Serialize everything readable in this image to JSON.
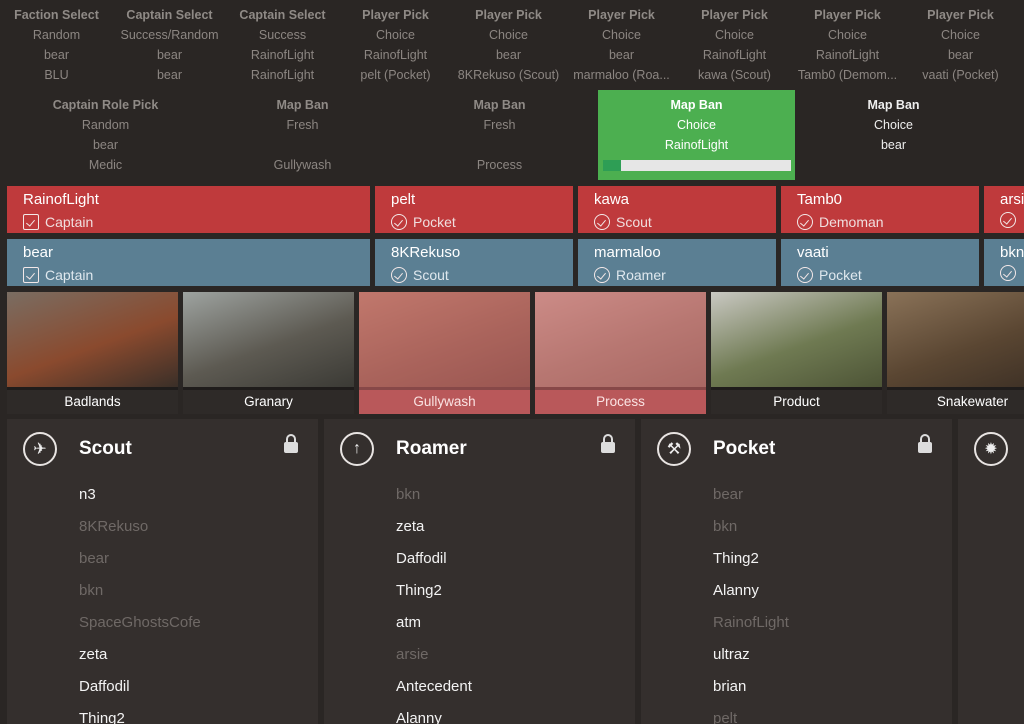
{
  "history_row1": [
    {
      "heading": "Faction Select",
      "lines": [
        "Random",
        "bear",
        "BLU"
      ]
    },
    {
      "heading": "Captain Select",
      "lines": [
        "Success/Random",
        "bear",
        "bear"
      ]
    },
    {
      "heading": "Captain Select",
      "lines": [
        "Success",
        "RainofLight",
        "RainofLight"
      ]
    },
    {
      "heading": "Player Pick",
      "lines": [
        "Choice",
        "RainofLight",
        "pelt (Pocket)"
      ]
    },
    {
      "heading": "Player Pick",
      "lines": [
        "Choice",
        "bear",
        "8KRekuso (Scout)"
      ]
    },
    {
      "heading": "Player Pick",
      "lines": [
        "Choice",
        "bear",
        "marmaloo (Roa..."
      ]
    },
    {
      "heading": "Player Pick",
      "lines": [
        "Choice",
        "RainofLight",
        "kawa (Scout)"
      ]
    },
    {
      "heading": "Player Pick",
      "lines": [
        "Choice",
        "RainofLight",
        "Tamb0 (Demom..."
      ]
    },
    {
      "heading": "Player Pick",
      "lines": [
        "Choice",
        "bear",
        "vaati (Pocket)"
      ]
    }
  ],
  "history_row2": [
    {
      "heading": "Captain Role Pick",
      "lines": [
        "Random",
        "bear",
        "Medic"
      ]
    },
    {
      "heading": "Map Ban",
      "lines": [
        "Fresh",
        "",
        "Gullywash"
      ]
    },
    {
      "heading": "Map Ban",
      "lines": [
        "Fresh",
        "",
        "Process"
      ]
    },
    {
      "heading": "Map Ban",
      "lines": [
        "Choice",
        "RainofLight"
      ],
      "active": true,
      "progress": 0.1
    },
    {
      "heading": "Map Ban",
      "lines": [
        "Choice",
        "bear"
      ],
      "white": true
    }
  ],
  "red_team": [
    {
      "name": "RainofLight",
      "role": "Captain",
      "icon": "clipboard-check-icon"
    },
    {
      "name": "pelt",
      "role": "Pocket",
      "icon": "pocket-icon"
    },
    {
      "name": "kawa",
      "role": "Scout",
      "icon": "scout-icon"
    },
    {
      "name": "Tamb0",
      "role": "Demoman",
      "icon": "demoman-icon"
    },
    {
      "name": "arsi",
      "role": "",
      "icon": "medic-icon"
    }
  ],
  "blu_team": [
    {
      "name": "bear",
      "role": "Captain",
      "icon": "clipboard-check-icon"
    },
    {
      "name": "8KRekuso",
      "role": "Scout",
      "icon": "scout-icon"
    },
    {
      "name": "marmaloo",
      "role": "Roamer",
      "icon": "roamer-icon"
    },
    {
      "name": "vaati",
      "role": "Pocket",
      "icon": "pocket-icon"
    },
    {
      "name": "bkn",
      "role": "",
      "icon": "medic-icon"
    }
  ],
  "maps": [
    {
      "name": "Badlands",
      "banned": false,
      "colors": [
        "#7a6d62",
        "#8a4a2e",
        "#3a2f28"
      ]
    },
    {
      "name": "Granary",
      "banned": false,
      "colors": [
        "#9ea3a0",
        "#5d5a52",
        "#3b3a35"
      ]
    },
    {
      "name": "Gullywash",
      "banned": true,
      "colors": [
        "#a0856c",
        "#6f5a48",
        "#4a3b30"
      ]
    },
    {
      "name": "Process",
      "banned": true,
      "colors": [
        "#b8b0a6",
        "#8a8276",
        "#6a6258"
      ]
    },
    {
      "name": "Product",
      "banned": false,
      "colors": [
        "#c9c8c2",
        "#6f7a52",
        "#4d5436"
      ]
    },
    {
      "name": "Snakewater",
      "banned": false,
      "colors": [
        "#8a7258",
        "#5a4632",
        "#3a2e24"
      ]
    }
  ],
  "class_columns": [
    {
      "title": "Scout",
      "icon": "scout-icon",
      "locked": true,
      "players": [
        {
          "n": "n3",
          "dim": false
        },
        {
          "n": "8KRekuso",
          "dim": true
        },
        {
          "n": "bear",
          "dim": true
        },
        {
          "n": "bkn",
          "dim": true
        },
        {
          "n": "SpaceGhostsCofe",
          "dim": true
        },
        {
          "n": "zeta",
          "dim": false
        },
        {
          "n": "Daffodil",
          "dim": false
        },
        {
          "n": "Thing2",
          "dim": false
        }
      ]
    },
    {
      "title": "Roamer",
      "icon": "roamer-icon",
      "locked": true,
      "players": [
        {
          "n": "bkn",
          "dim": true
        },
        {
          "n": "zeta",
          "dim": false
        },
        {
          "n": "Daffodil",
          "dim": false
        },
        {
          "n": "Thing2",
          "dim": false
        },
        {
          "n": "atm",
          "dim": false
        },
        {
          "n": "arsie",
          "dim": true
        },
        {
          "n": "Antecedent",
          "dim": false
        },
        {
          "n": "Alanny",
          "dim": false
        }
      ]
    },
    {
      "title": "Pocket",
      "icon": "pocket-icon",
      "locked": true,
      "players": [
        {
          "n": "bear",
          "dim": true
        },
        {
          "n": "bkn",
          "dim": true
        },
        {
          "n": "Thing2",
          "dim": false
        },
        {
          "n": "Alanny",
          "dim": false
        },
        {
          "n": "RainofLight",
          "dim": true
        },
        {
          "n": "ultraz",
          "dim": false
        },
        {
          "n": "brian",
          "dim": false
        },
        {
          "n": "pelt",
          "dim": true
        }
      ]
    },
    {
      "title": "",
      "icon": "demoman-icon",
      "locked": false,
      "players": []
    }
  ]
}
